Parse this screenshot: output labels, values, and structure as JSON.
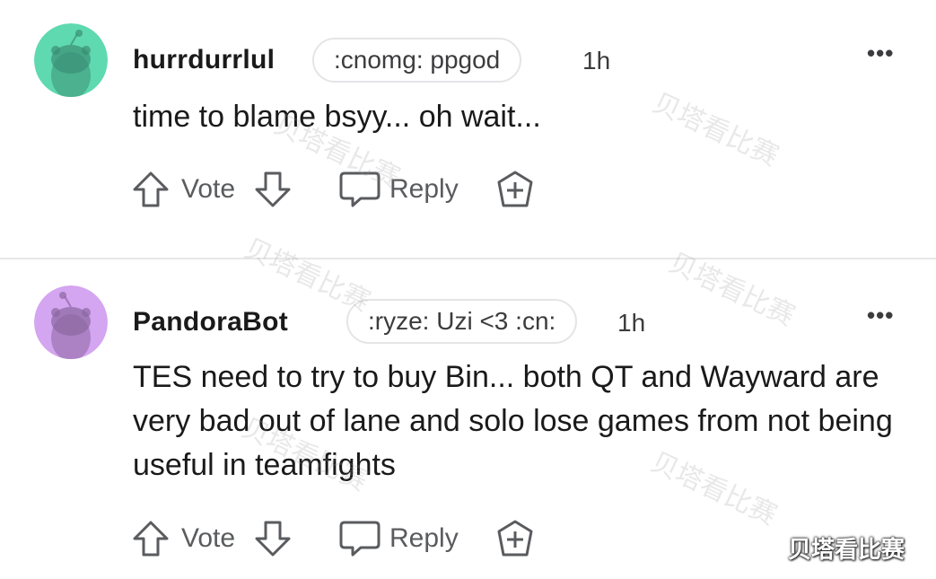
{
  "comments": [
    {
      "username": "hurrdurrlul",
      "flair": ":cnomg: ppgod",
      "time": "1h",
      "more": "•••",
      "body": "time to blame bsyy... oh wait...",
      "avatar_color": "#5fd9b0",
      "avatar_figure_color": "#3a8f74",
      "actions": {
        "vote": "Vote",
        "reply": "Reply"
      }
    },
    {
      "username": "PandoraBot",
      "flair": ":ryze: Uzi <3 :cn:",
      "time": "1h",
      "more": "•••",
      "body": "TES need to try to buy Bin... both QT and Wayward are very bad out of lane and solo lose games from not being useful in teamfights",
      "avatar_color": "#d4a5f0",
      "avatar_figure_color": "#8a66a0",
      "actions": {
        "vote": "Vote",
        "reply": "Reply"
      }
    }
  ],
  "watermark": "贝塔看比赛",
  "icons": {
    "upvote": "upvote-arrow-icon",
    "downvote": "downvote-arrow-icon",
    "reply": "comment-bubble-icon",
    "award": "award-plus-icon",
    "more": "more-dots-icon",
    "avatar": "snoo-avatar-icon"
  },
  "colors": {
    "text": "#1a1a1b",
    "muted": "#5a5b5e",
    "divider": "#e6e7e9"
  }
}
